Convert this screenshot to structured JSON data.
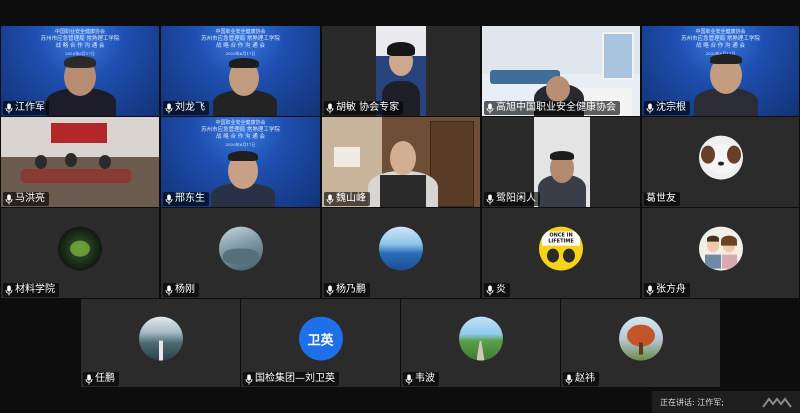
{
  "row1": [
    {
      "name": "江作军",
      "banner": {
        "l1": "中国职业安全健康协会",
        "l2": "苏州市应急管理局   常熟理工学院",
        "l3": "战 略 合 作 沟 通 会",
        "l4": "2020年6月17日"
      }
    },
    {
      "name": "刘龙飞",
      "banner": {
        "l1": "中国职业安全健康协会",
        "l2": "苏州市应急管理局   常熟理工学院",
        "l3": "战 略 合 作 沟 通 会",
        "l4": "2020年6月17日"
      }
    },
    {
      "name": "胡敏 协会专家"
    },
    {
      "name": "高旭中国职业安全健康协会"
    },
    {
      "name": "沈宗根",
      "banner": {
        "l1": "中国职业安全健康协会",
        "l2": "苏州市应急管理局   常熟理工学院",
        "l3": "战 略 合 作 沟 通 会",
        "l4": "2020年6月17日"
      }
    }
  ],
  "row2": [
    {
      "name": "马洪亮"
    },
    {
      "name": "邢东生",
      "banner": {
        "l1": "中国职业安全健康协会",
        "l2": "苏州市应急管理局   常熟理工学院",
        "l3": "战 略 合 作 沟 通 会",
        "l4": "2020年6月17日"
      }
    },
    {
      "name": "魏山峰"
    },
    {
      "name": "鹭阳闲人"
    },
    {
      "name": "葛世友"
    }
  ],
  "row3": [
    {
      "name": "材料学院"
    },
    {
      "name": "杨刚"
    },
    {
      "name": "杨乃鹏"
    },
    {
      "name": "炎",
      "avatar_text": "ONCE IN LIFETIME"
    },
    {
      "name": "张方舟"
    }
  ],
  "row4": [
    {
      "name": "任鹏"
    },
    {
      "name": "国检集团—刘卫英",
      "avatar_text": "卫英"
    },
    {
      "name": "韦波"
    },
    {
      "name": "赵祎"
    }
  ],
  "status": {
    "speaking": "正在讲话: 江作军;"
  },
  "colors": {
    "active_border": "#2ec24a",
    "avatar_blue": "#1e6fe8",
    "banner_blue": "#1e4fb0"
  }
}
